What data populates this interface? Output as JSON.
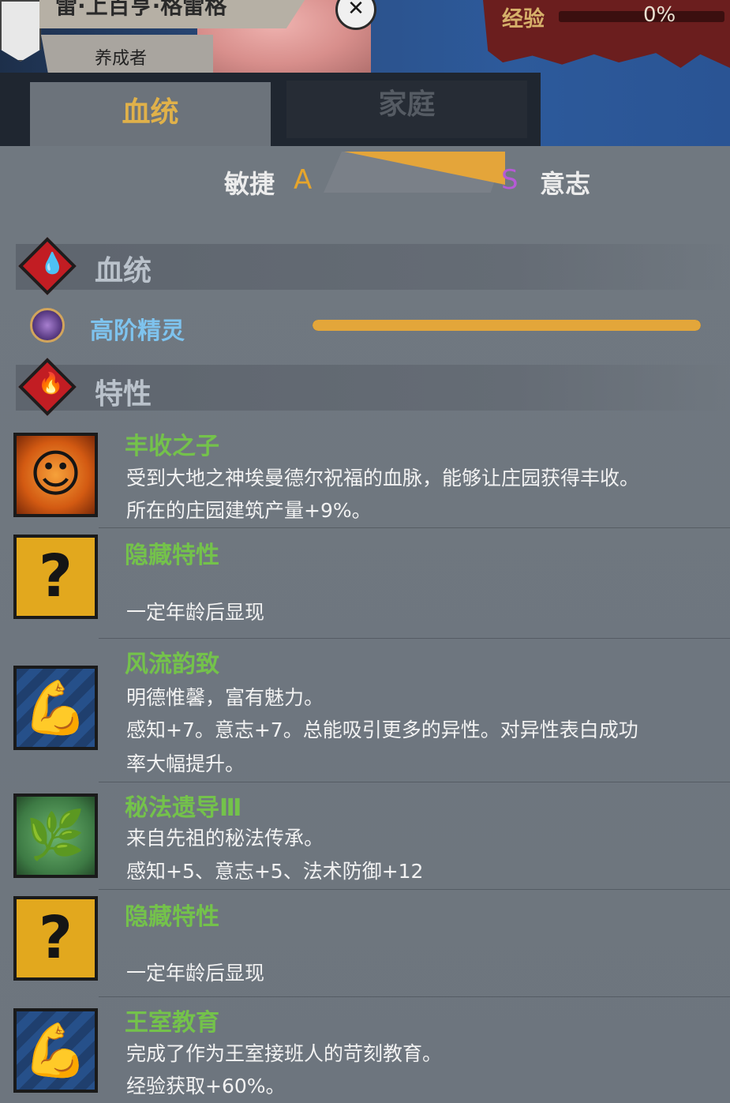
{
  "header": {
    "name": "雷·上百亨·格雷格",
    "role": "养成者",
    "close_icon": "close-icon",
    "emblem_icon": "house-emblem-icon",
    "xp": {
      "label": "经验",
      "value": "0%"
    }
  },
  "tabs": [
    {
      "label": "血统",
      "active": true
    },
    {
      "label": "家庭",
      "active": false
    }
  ],
  "attribute": {
    "left_label": "敏捷",
    "left_grade": "A",
    "right_grade": "S",
    "right_label": "意志"
  },
  "sections": {
    "bloodline": {
      "title": "血统",
      "icon": "blood-drop-icon"
    },
    "traits": {
      "title": "特性",
      "icon": "flame-icon"
    }
  },
  "bloodline": {
    "name": "高阶精灵",
    "icon": "elf-bloodline-icon",
    "purity": 1.0
  },
  "traits": [
    {
      "title": "丰收之子",
      "icon": "sun-face-icon",
      "lines": [
        "受到大地之神埃曼德尔祝福的血脉，能够让庄园获得丰收。",
        "所在的庄园建筑产量+9%。"
      ]
    },
    {
      "title": "隐藏特性",
      "icon": "question-mark-icon",
      "lines": [
        "一定年龄后显现"
      ]
    },
    {
      "title": "风流韵致",
      "icon": "flexed-arm-icon",
      "lines": [
        "明德惟馨，富有魅力。",
        "感知+7。意志+7。总能吸引更多的异性。对异性表白成功",
        "率大幅提升。"
      ]
    },
    {
      "title": "秘法遗导Ⅲ",
      "icon": "leaf-branch-icon",
      "lines": [
        "来自先祖的秘法传承。",
        "感知+5、意志+5、法术防御+12"
      ]
    },
    {
      "title": "隐藏特性",
      "icon": "question-mark-icon",
      "lines": [
        "一定年龄后显现"
      ]
    },
    {
      "title": "王室教育",
      "icon": "flexed-arm-icon",
      "lines": [
        "完成了作为王室接班人的苛刻教育。",
        "经验获取+60%。"
      ]
    }
  ]
}
